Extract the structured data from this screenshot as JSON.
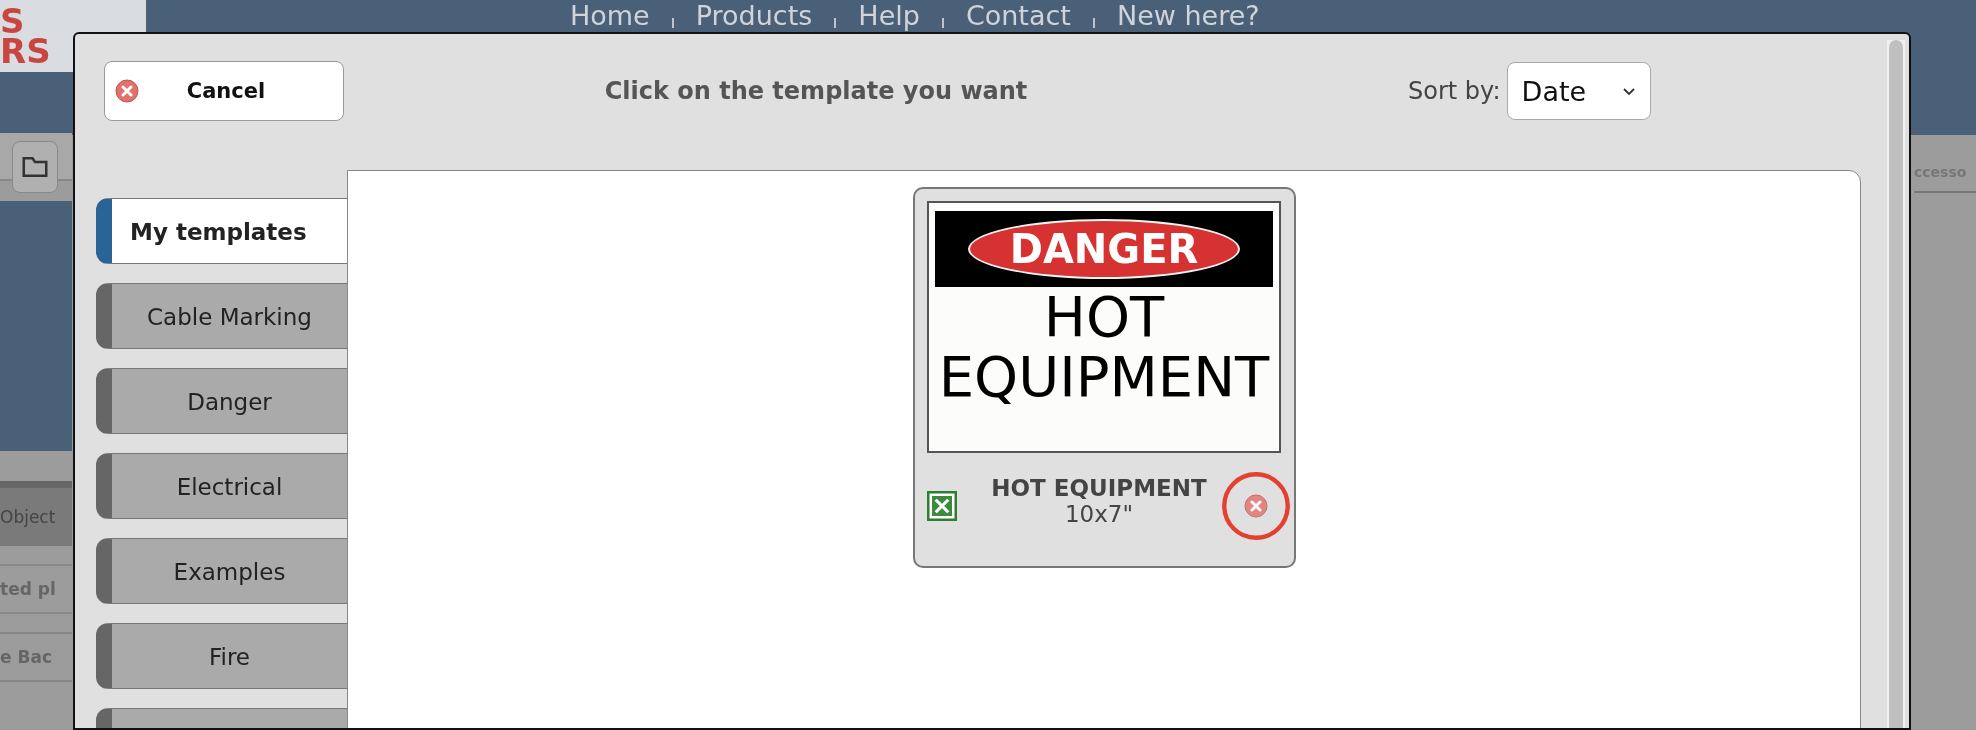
{
  "background": {
    "logo": {
      "lines": [
        "S",
        "RS"
      ]
    },
    "nav": [
      "Home",
      "Products",
      "Help",
      "Contact",
      "New here?"
    ],
    "left_labels": [
      {
        "kind": "tab",
        "text": "Object"
      },
      {
        "kind": "bold",
        "text": "ted pl"
      },
      {
        "kind": "bold",
        "text": "e Bac"
      }
    ],
    "right_label": "ccesso"
  },
  "dialog": {
    "cancel": "Cancel",
    "title": "Click on the template you want",
    "sort_label": "Sort by:",
    "sort_value": "Date",
    "tabs": [
      {
        "label": "My templates",
        "selected": true
      },
      {
        "label": "Cable Marking",
        "selected": false
      },
      {
        "label": "Danger",
        "selected": false
      },
      {
        "label": "Electrical",
        "selected": false
      },
      {
        "label": "Examples",
        "selected": false
      },
      {
        "label": "Fire",
        "selected": false
      },
      {
        "selected": false
      }
    ],
    "templates": [
      {
        "preview": {
          "header": "DANGER",
          "lines": [
            "HOT",
            "EQUIPMENT"
          ]
        },
        "name": "HOT EQUIPMENT",
        "size": "10x7\"",
        "delete_highlighted": true
      }
    ]
  }
}
